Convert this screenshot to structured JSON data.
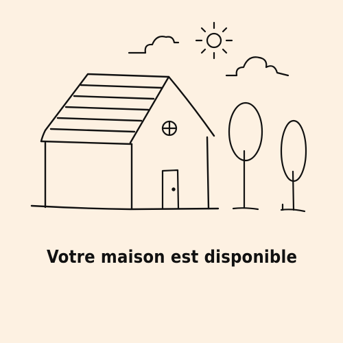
{
  "caption": {
    "text": "Votre maison est disponible"
  },
  "colors": {
    "background": "#fdf1e2",
    "ink": "#111111"
  },
  "icons": [
    "house-illustration",
    "sun-icon",
    "cloud-icon",
    "tree-icon",
    "round-window-icon",
    "door-icon"
  ]
}
